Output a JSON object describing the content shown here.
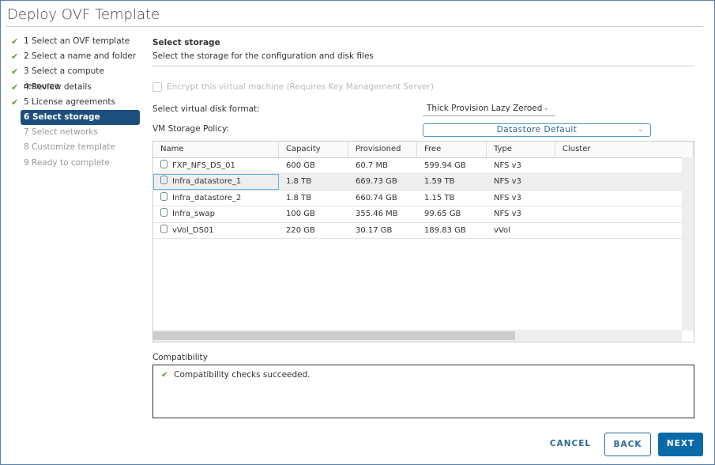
{
  "title": "Deploy OVF Template",
  "steps": [
    {
      "label": "1 Select an OVF template",
      "state": "done"
    },
    {
      "label": "2 Select a name and folder",
      "state": "done"
    },
    {
      "label": "3 Select a compute resource",
      "state": "done"
    },
    {
      "label": "4 Review details",
      "state": "done"
    },
    {
      "label": "5 License agreements",
      "state": "done"
    },
    {
      "label": "6 Select storage",
      "state": "active"
    },
    {
      "label": "7 Select networks",
      "state": "todo"
    },
    {
      "label": "8 Customize template",
      "state": "todo"
    },
    {
      "label": "9 Ready to complete",
      "state": "todo"
    }
  ],
  "main": {
    "heading": "Select storage",
    "subheading": "Select the storage for the configuration and disk files",
    "encrypt_label": "Encrypt this virtual machine (Requires Key Management Server)",
    "encrypt_checked": false,
    "disk_format_label": "Select virtual disk format:",
    "disk_format_value": "Thick Provision Lazy Zeroed",
    "policy_label": "VM Storage Policy:",
    "policy_value": "Datastore Default"
  },
  "table": {
    "columns": [
      "Name",
      "Capacity",
      "Provisioned",
      "Free",
      "Type",
      "Cluster"
    ],
    "selected_index": 1,
    "rows": [
      [
        "FXP_NFS_DS_01",
        "600 GB",
        "60.7 MB",
        "599.94 GB",
        "NFS v3",
        ""
      ],
      [
        "Infra_datastore_1",
        "1.8 TB",
        "669.73 GB",
        "1.59 TB",
        "NFS v3",
        ""
      ],
      [
        "Infra_datastore_2",
        "1.8 TB",
        "660.74 GB",
        "1.15 TB",
        "NFS v3",
        ""
      ],
      [
        "Infra_swap",
        "100 GB",
        "355.46 MB",
        "99.65 GB",
        "NFS v3",
        ""
      ],
      [
        "vVol_DS01",
        "220 GB",
        "30.17 GB",
        "189.83 GB",
        "vVol",
        ""
      ]
    ]
  },
  "compatibility": {
    "label": "Compatibility",
    "message": "Compatibility checks succeeded."
  },
  "buttons": {
    "cancel": "CANCEL",
    "back": "BACK",
    "next": "NEXT"
  },
  "colors": {
    "accent": "#0a6aa8",
    "active_step": "#1d4f7c",
    "check": "#5aa220"
  }
}
